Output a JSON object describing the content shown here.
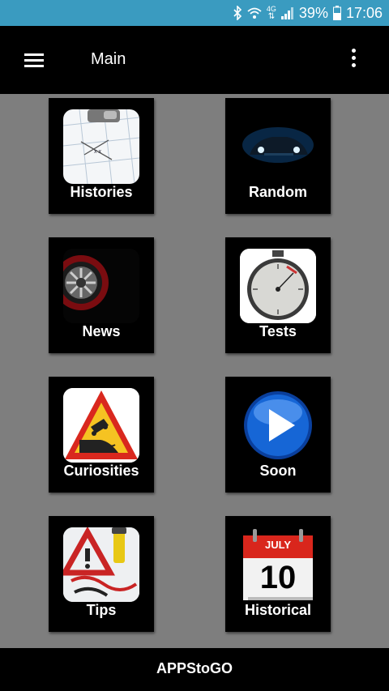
{
  "status": {
    "battery": "39%",
    "time": "17:06",
    "network": "4G"
  },
  "appbar": {
    "title": "Main"
  },
  "tiles": [
    {
      "label": "Histories"
    },
    {
      "label": "Random"
    },
    {
      "label": "News"
    },
    {
      "label": "Tests"
    },
    {
      "label": "Curiosities"
    },
    {
      "label": "Soon"
    },
    {
      "label": "Tips"
    },
    {
      "label": "Historical",
      "calendar_month": "JULY",
      "calendar_day": "10"
    }
  ],
  "footer": {
    "label": "APPStoGO"
  },
  "colors": {
    "statusbar": "#3a9bc0",
    "background": "#7e7e7e",
    "bar": "#000000"
  },
  "icons": [
    "bluetooth-icon",
    "wifi-icon",
    "signal-icon",
    "battery-icon",
    "menu-icon",
    "more-vert-icon"
  ]
}
